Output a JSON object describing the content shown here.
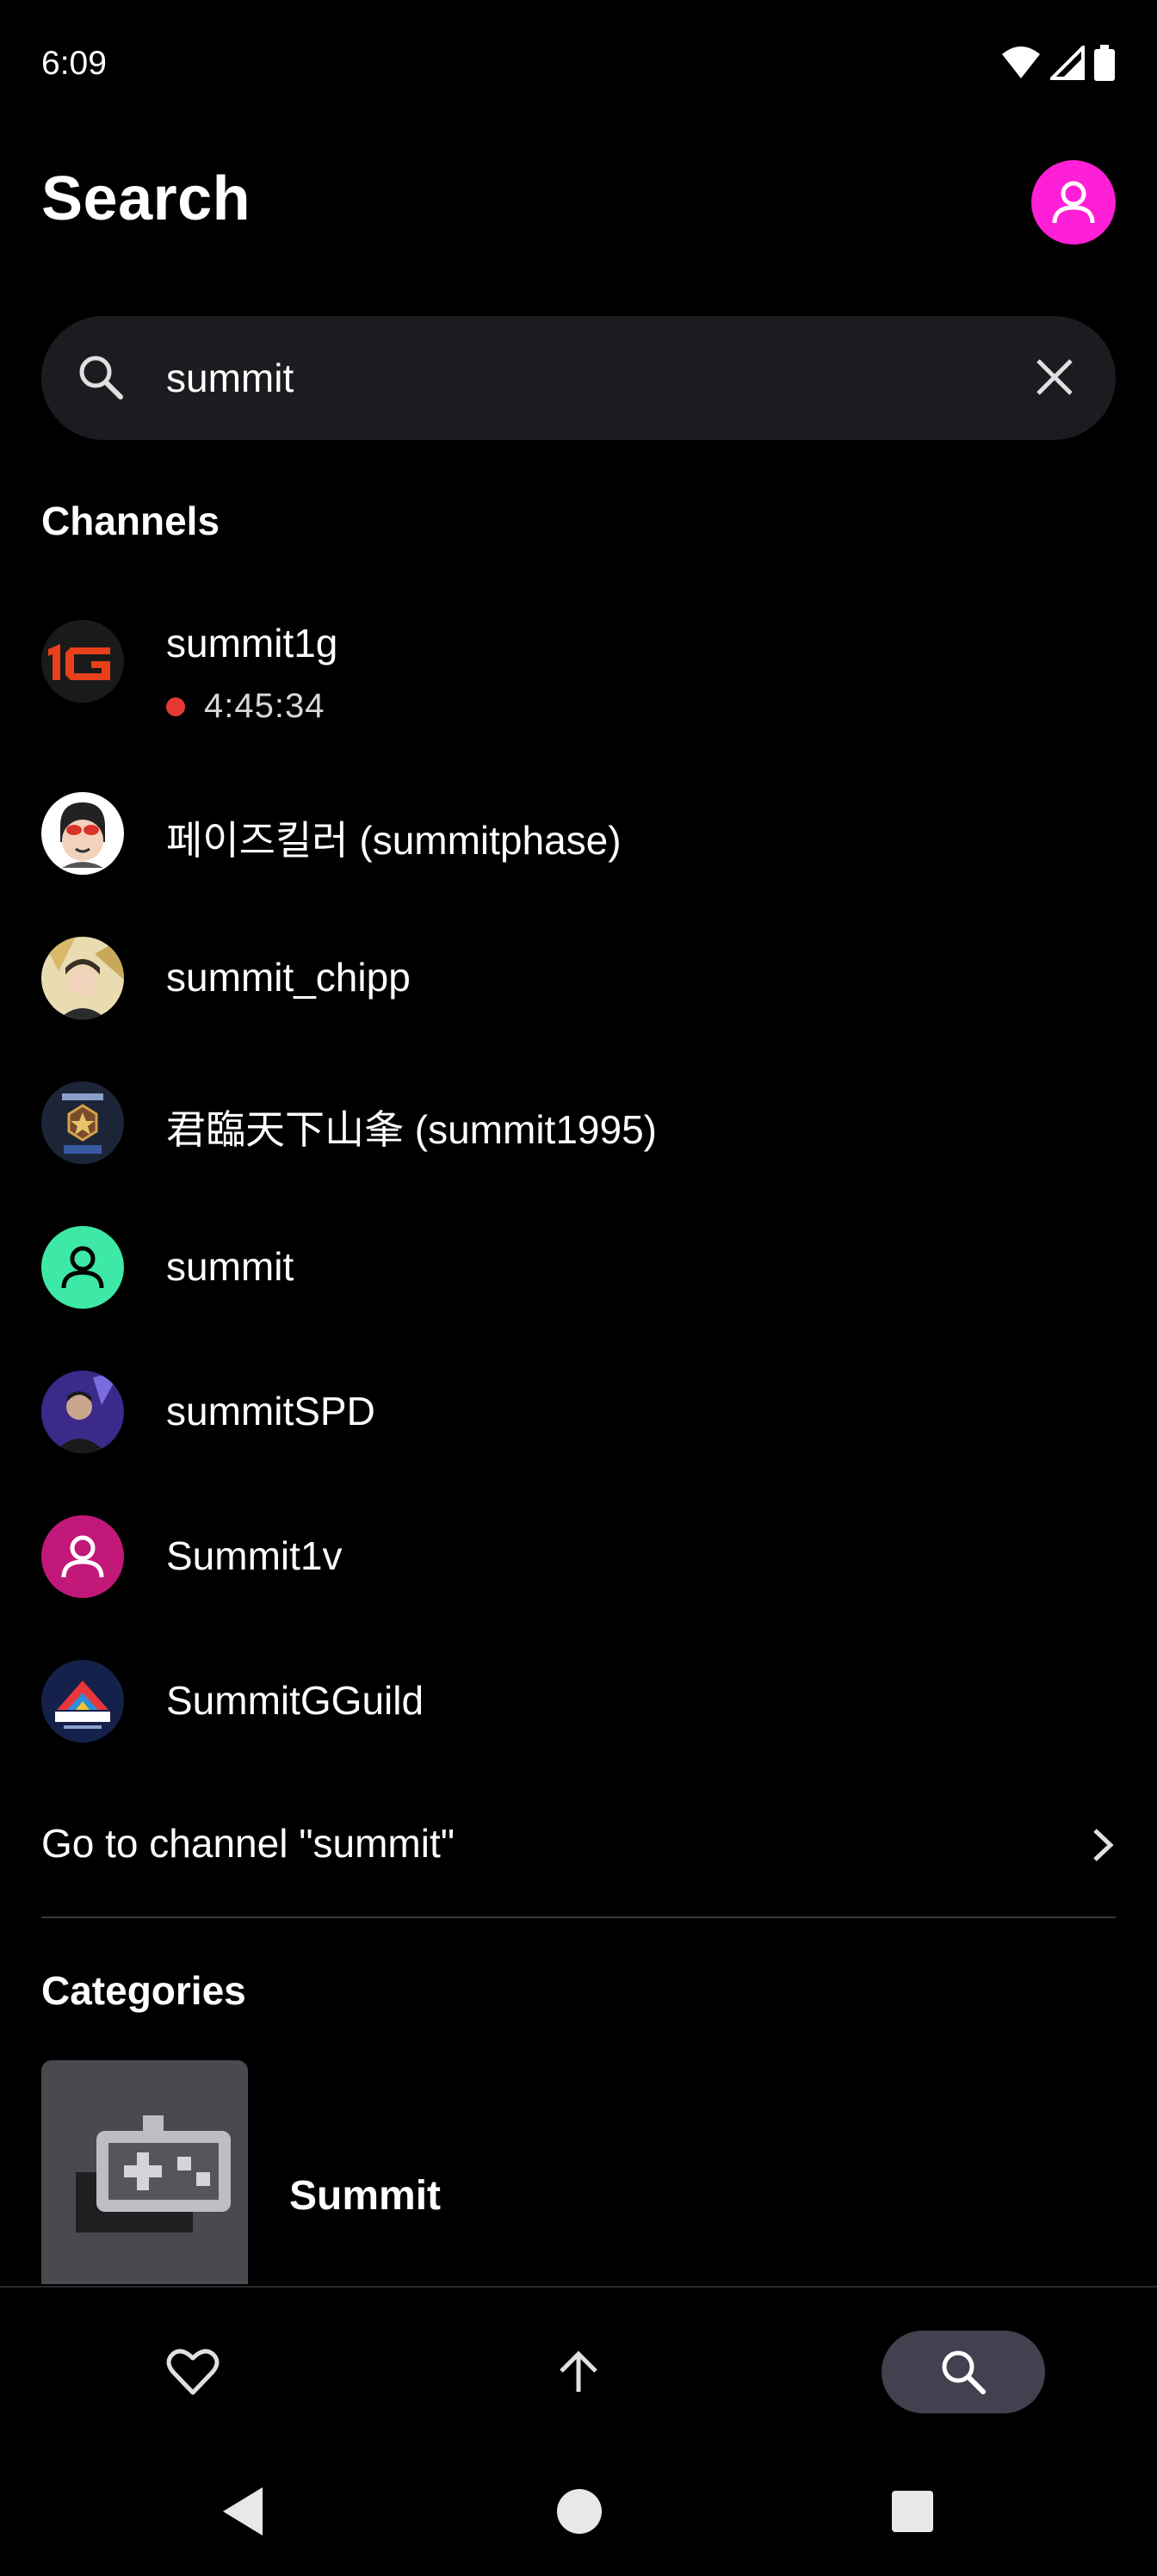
{
  "status_bar": {
    "time": "6:09",
    "icons": [
      "wifi-icon",
      "cell-signal-icon",
      "battery-icon"
    ]
  },
  "header": {
    "title": "Search",
    "profile_icon": "user-icon",
    "profile_color": "#ff1fd6"
  },
  "search": {
    "value": "summit",
    "icon": "search-icon",
    "clear_icon": "close-icon"
  },
  "channels": {
    "section_title": "Channels",
    "items": [
      {
        "name": "summit1g",
        "live": true,
        "live_duration": "4:45:34",
        "avatar": "1g-logo"
      },
      {
        "name": "페이즈킬러 (summitphase)",
        "avatar": "cartoon-avatar"
      },
      {
        "name": "summit_chipp",
        "avatar": "illustrated-avatar"
      },
      {
        "name": "君臨天下山夆 (summit1995)",
        "avatar": "emblem-avatar"
      },
      {
        "name": "summit",
        "avatar": "default-user",
        "avatar_color": "#3ee8a6"
      },
      {
        "name": "summitSPD",
        "avatar": "photo-avatar"
      },
      {
        "name": "Summit1v",
        "avatar": "default-user",
        "avatar_color": "#c2187a"
      },
      {
        "name": "SummitGGuild",
        "avatar": "summit-gaming-guild-logo"
      }
    ],
    "goto_label": "Go to channel \"summit\""
  },
  "categories": {
    "section_title": "Categories",
    "items": [
      {
        "name": "Summit",
        "thumb_icon": "gamepad-icon"
      }
    ]
  },
  "bottom_nav": [
    {
      "icon": "heart-icon",
      "active": false
    },
    {
      "icon": "arrow-up-icon",
      "active": false
    },
    {
      "icon": "search-icon",
      "active": true
    }
  ],
  "system_nav": [
    "back-icon",
    "home-icon",
    "recents-icon"
  ]
}
